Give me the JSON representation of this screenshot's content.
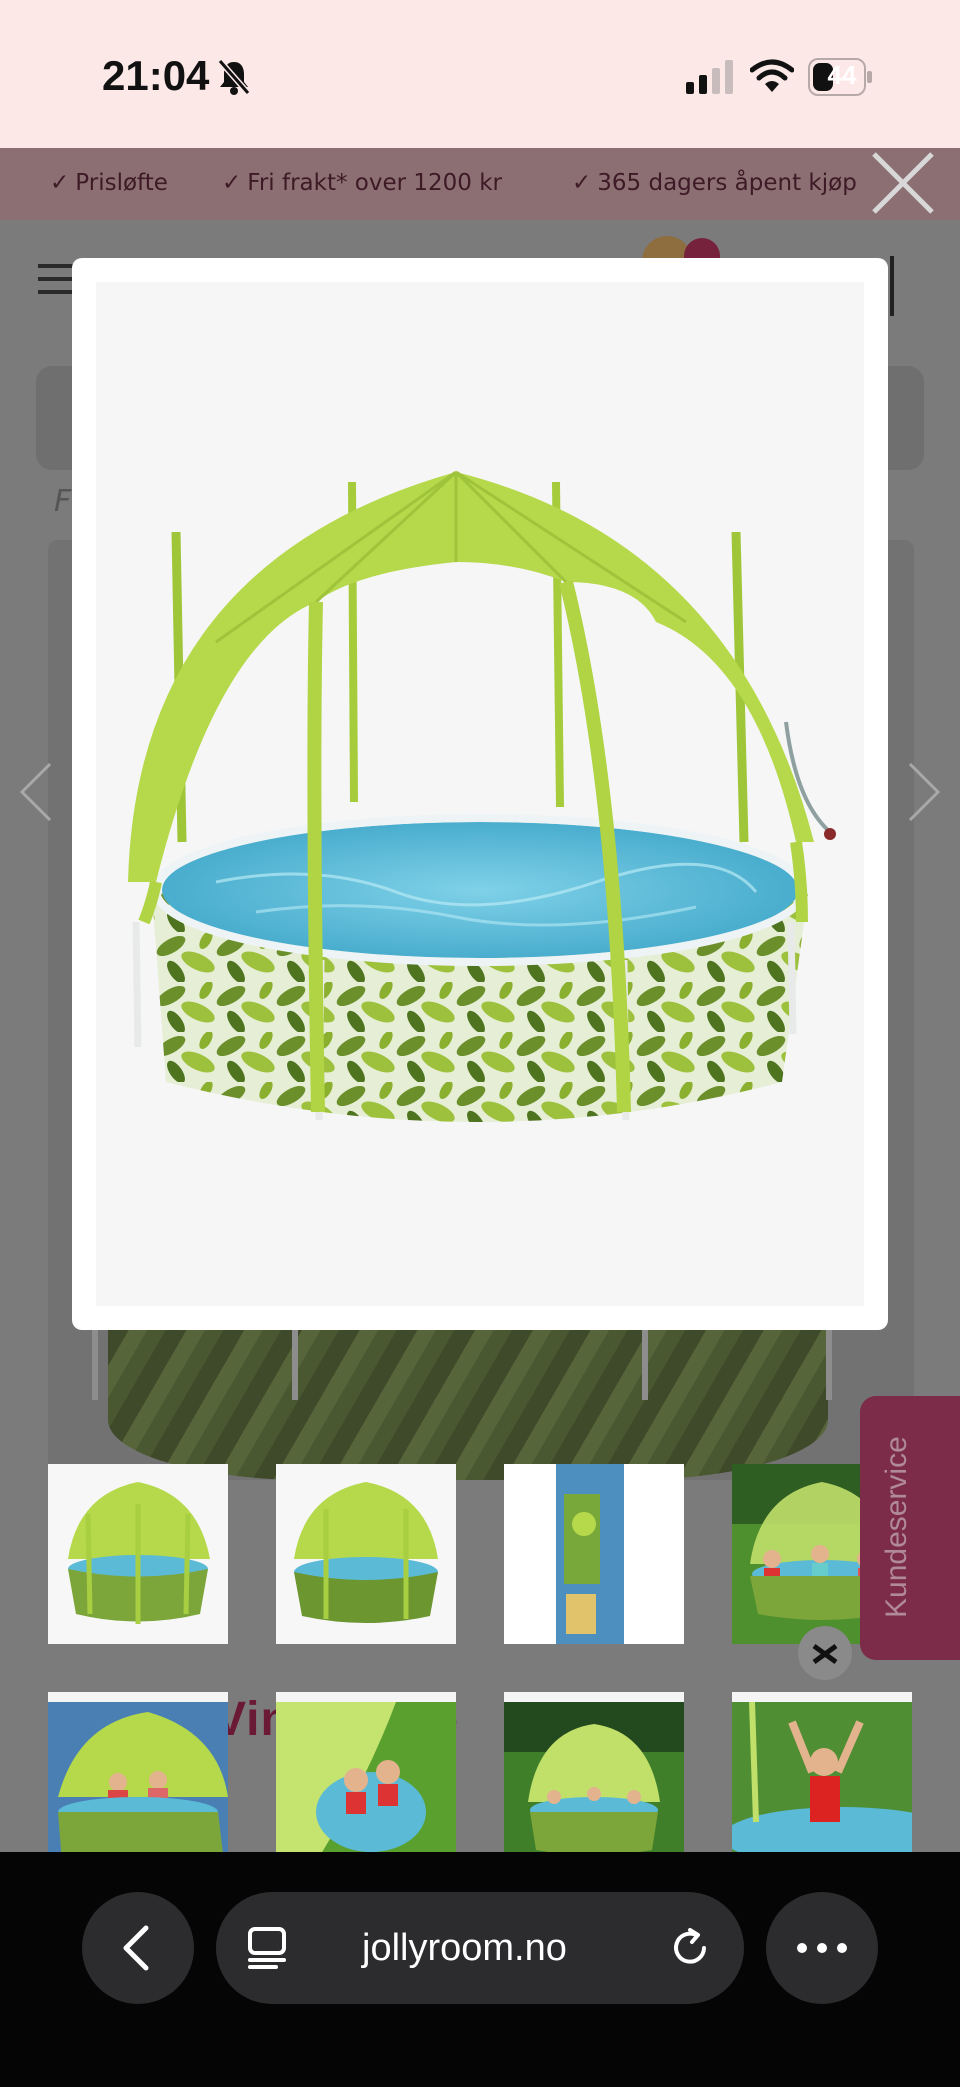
{
  "status_bar": {
    "time": "21:04",
    "battery": "44",
    "battery_fraction": 0.44
  },
  "promo": {
    "items": [
      "Prisløfte",
      "Fri frakt* over 1200 kr",
      "365 dagers åpent kjøp"
    ],
    "check_glyph": "✓"
  },
  "background_page": {
    "breadcrumb_fragment": "F",
    "banner_text": "Vin    or r    ke",
    "customer_service_tab": "Kundeservice"
  },
  "gallery": {
    "thumbnails": [
      {
        "alt": "pool-canopy-front"
      },
      {
        "alt": "pool-canopy-side"
      },
      {
        "alt": "package-box"
      },
      {
        "alt": "kids-in-pool-garden"
      },
      {
        "alt": "kids-arms-raised"
      },
      {
        "alt": "kids-closeup-canopy"
      },
      {
        "alt": "pool-lawn-kids"
      },
      {
        "alt": "girl-red-swimsuit"
      }
    ]
  },
  "browser": {
    "url": "jollyroom.no"
  },
  "colors": {
    "status_bg": "#fde8e8",
    "promo_text": "#3e1a26",
    "brand": "#7c2b49",
    "canopy": "#b5d94a",
    "water": "#5bbad6"
  },
  "icons": [
    "bell-slash-icon",
    "signal-icon",
    "wifi-icon",
    "battery-icon",
    "close-icon",
    "chevron-left-icon",
    "chevron-right-icon",
    "hamburger-icon",
    "tabs-icon",
    "reload-icon",
    "more-icon"
  ]
}
